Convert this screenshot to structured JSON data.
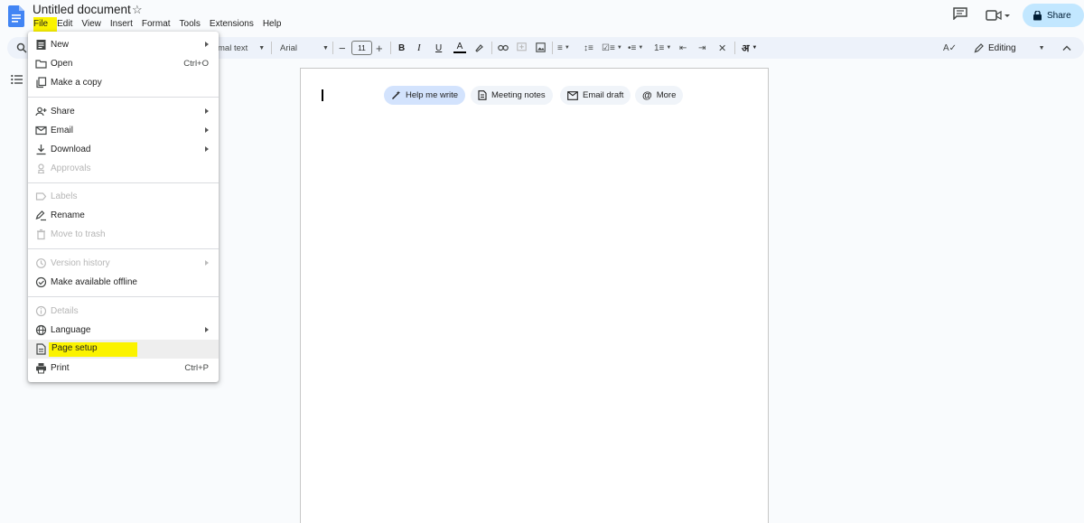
{
  "document": {
    "title": "Untitled document"
  },
  "menubar": [
    "File",
    "Edit",
    "View",
    "Insert",
    "Format",
    "Tools",
    "Extensions",
    "Help"
  ],
  "header": {
    "share_label": "Share"
  },
  "toolbar": {
    "style_label": "mal text",
    "font_label": "Arial",
    "font_size": "11",
    "mode_label": "Editing"
  },
  "chips": [
    {
      "label": "Help me write",
      "icon": "pen-sparkle-icon"
    },
    {
      "label": "Meeting notes",
      "icon": "document-icon"
    },
    {
      "label": "Email draft",
      "icon": "email-icon"
    },
    {
      "label": "More",
      "icon": "at-icon"
    }
  ],
  "file_menu": {
    "items": [
      {
        "label": "New",
        "icon": "document-icon",
        "submenu": true,
        "disabled": false
      },
      {
        "label": "Open",
        "icon": "folder-icon",
        "shortcut": "Ctrl+O",
        "disabled": false
      },
      {
        "label": "Make a copy",
        "icon": "copy-icon",
        "disabled": false
      },
      {
        "label": "Share",
        "icon": "person-add-icon",
        "submenu": true,
        "disabled": false
      },
      {
        "label": "Email",
        "icon": "email-icon",
        "submenu": true,
        "disabled": false
      },
      {
        "label": "Download",
        "icon": "download-icon",
        "submenu": true,
        "disabled": false
      },
      {
        "label": "Approvals",
        "icon": "approval-icon",
        "disabled": true
      },
      {
        "label": "Labels",
        "icon": "label-icon",
        "disabled": true
      },
      {
        "label": "Rename",
        "icon": "rename-icon",
        "disabled": false
      },
      {
        "label": "Move to trash",
        "icon": "trash-icon",
        "disabled": true
      },
      {
        "label": "Version history",
        "icon": "history-icon",
        "submenu": true,
        "disabled": true
      },
      {
        "label": "Make available offline",
        "icon": "offline-icon",
        "disabled": false
      },
      {
        "label": "Details",
        "icon": "info-icon",
        "disabled": true
      },
      {
        "label": "Language",
        "icon": "globe-icon",
        "submenu": true,
        "disabled": false
      },
      {
        "label": "Page setup",
        "icon": "page-setup-icon",
        "disabled": false,
        "highlighted": true
      },
      {
        "label": "Print",
        "icon": "print-icon",
        "shortcut": "Ctrl+P",
        "disabled": false
      }
    ]
  },
  "colors": {
    "highlight": "#fbf300",
    "share_button": "#c2e7ff",
    "toolbar_bg": "#edf2fa",
    "docs_blue": "#4285f4"
  }
}
